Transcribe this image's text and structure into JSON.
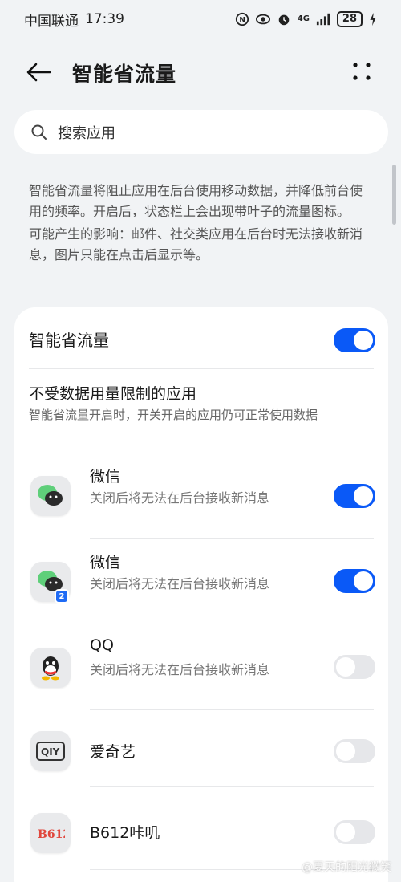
{
  "status_bar": {
    "carrier": "中国联通",
    "time": "17:39",
    "network": "4G",
    "battery": "28"
  },
  "header": {
    "title": "智能省流量"
  },
  "search": {
    "placeholder": "搜索应用"
  },
  "description": {
    "line1": "智能省流量将阻止应用在后台使用移动数据，并降低前台使用的频率。开启后，状态栏上会出现带叶子的流量图标。",
    "line2": "可能产生的影响：邮件、社交类应用在后台时无法接收新消息，图片只能在点击后显示等。"
  },
  "main_toggle": {
    "label": "智能省流量",
    "on": true
  },
  "unrestricted": {
    "title": "不受数据用量限制的应用",
    "subtitle": "智能省流量开启时，开关开启的应用仍可正常使用数据"
  },
  "apps": [
    {
      "name": "微信",
      "desc": "关闭后将无法在后台接收新消息",
      "on": true,
      "icon": "wechat-icon",
      "badge": ""
    },
    {
      "name": "微信",
      "desc": "关闭后将无法在后台接收新消息",
      "on": true,
      "icon": "wechat-icon",
      "badge": "2"
    },
    {
      "name": "QQ",
      "desc": "关闭后将无法在后台接收新消息",
      "on": false,
      "icon": "qq-icon",
      "badge": ""
    },
    {
      "name": "爱奇艺",
      "desc": "",
      "on": false,
      "icon": "iqiyi-icon",
      "badge": ""
    },
    {
      "name": "B612咔叽",
      "desc": "",
      "on": false,
      "icon": "b612-icon",
      "badge": ""
    }
  ],
  "watermark": "@夏天的阳光微笑",
  "colors": {
    "accent": "#0a59f7",
    "background": "#f1f3f5",
    "toggle_off": "#e6e7ea"
  }
}
